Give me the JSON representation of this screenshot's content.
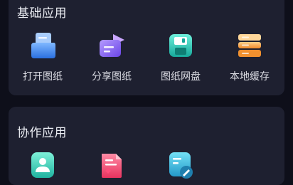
{
  "sections": {
    "basic": {
      "title": "基础应用",
      "items": [
        {
          "label": "打开图纸",
          "icon": "open-drawing-icon"
        },
        {
          "label": "分享图纸",
          "icon": "share-drawing-icon"
        },
        {
          "label": "图纸网盘",
          "icon": "cloud-disk-icon"
        },
        {
          "label": "本地缓存",
          "icon": "local-cache-icon"
        }
      ]
    },
    "collab": {
      "title": "协作应用",
      "items": [
        {
          "icon": "contact-icon"
        },
        {
          "icon": "document-icon"
        },
        {
          "icon": "annotate-icon"
        }
      ]
    }
  },
  "colors": {
    "background": "#0e0f1a",
    "card": "#1e2030",
    "blue": "#3d8bf2",
    "purple": "#8a6cf0",
    "teal": "#2fc9b6",
    "orange": "#f2a545",
    "pink": "#f25a7a"
  }
}
